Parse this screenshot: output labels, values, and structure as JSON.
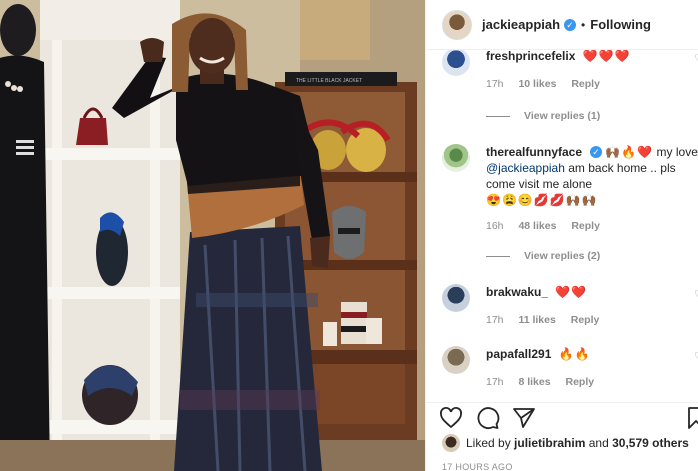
{
  "post": {
    "username": "jackieappiah",
    "follow_status": "Following",
    "separator": "•",
    "verified_mark": "✓",
    "photo_book_text": "THE LITTLE BLACK JACKET"
  },
  "comments": [
    {
      "username": "freshprincefelix",
      "text": "",
      "emoji": "❤️❤️❤️",
      "time": "17h",
      "likes": "10 likes",
      "reply": "Reply",
      "view_replies": "View replies (1)"
    },
    {
      "username": "therealfunnyface",
      "verified": true,
      "emoji_prefix": "🙌🏾🔥❤️",
      "text": "my love ",
      "mention": "@jackieappiah",
      "text_after": " am back home .. pls come visit me alone",
      "emoji_suffix": "😍😩😊💋💋🙌🏾🙌🏾",
      "time": "16h",
      "likes": "48 likes",
      "reply": "Reply",
      "view_replies": "View replies (2)"
    },
    {
      "username": "brakwaku_",
      "text": "",
      "emoji": "❤️❤️",
      "time": "17h",
      "likes": "11 likes",
      "reply": "Reply"
    },
    {
      "username": "papafall291",
      "text": "",
      "emoji": "🔥🔥",
      "time": "17h",
      "likes": "8 likes",
      "reply": "Reply"
    }
  ],
  "actions": {
    "icons": [
      "heart-icon",
      "comment-icon",
      "share-icon",
      "bookmark-icon"
    ]
  },
  "likes_line": {
    "prefix": "Liked by ",
    "user": "julietibrahim",
    "middle": " and ",
    "count": "30,579 others"
  },
  "time_ago": "17 HOURS AGO",
  "colors": {
    "link": "#00376b",
    "verified": "#3897f0",
    "muted": "#8e8e8e",
    "heart_red": "#ed4956"
  }
}
